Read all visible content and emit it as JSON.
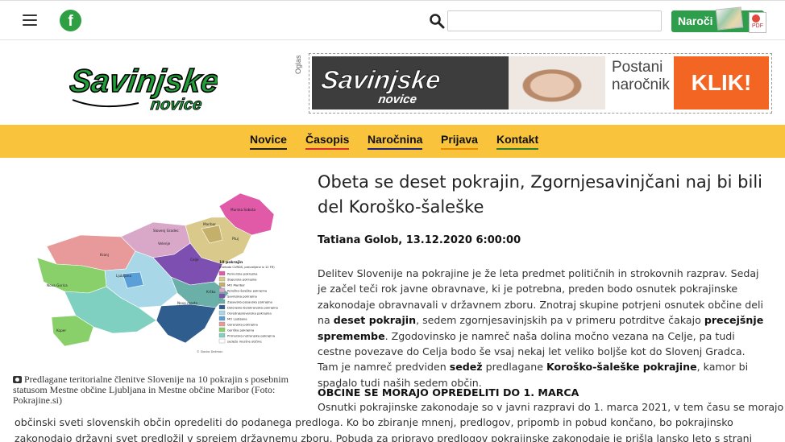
{
  "topbar": {
    "menu_icon": "hamburger-icon",
    "facebook_icon": "facebook-icon",
    "facebook_letter": "f",
    "search_icon": "search-icon",
    "search_placeholder": "",
    "subscribe_label": "Naroči",
    "pdf_label": "PDF"
  },
  "header": {
    "logo_main": "Savinjske",
    "logo_sub": "novice",
    "ad_label": "Oglas",
    "ad_logo_main": "Savinjske",
    "ad_logo_sub": "novice",
    "ad_line1": "Postani",
    "ad_line2": "naročnik",
    "ad_cta": "KLIK!"
  },
  "nav": {
    "items": [
      {
        "label": "Novice",
        "underline": "#222222"
      },
      {
        "label": "Časopis",
        "underline": "#d32f2f"
      },
      {
        "label": "Naročnina",
        "underline": "#1a237e"
      },
      {
        "label": "Prijava",
        "underline": "#e68a00"
      },
      {
        "label": "Kontakt",
        "underline": "#2e7d32"
      }
    ]
  },
  "colors": {
    "brand_green": "#2e9e4d",
    "nav_yellow": "#f9c33c",
    "ad_orange": "#f26522"
  },
  "map": {
    "legend_title": "10 pokrajin",
    "legend_subtitle": "(metoda CURDS, preureijene iz 12 FR)",
    "legend": [
      {
        "label": "Pomurska pokrajina",
        "color": "#e05aa8"
      },
      {
        "label": "Štajerska pokrajina",
        "color": "#d9c98a"
      },
      {
        "label": "MO Maribor",
        "color": "#c4b06a"
      },
      {
        "label": "Koroško-šaleška pokrajina",
        "color": "#d9a8c8"
      },
      {
        "label": "Savinjska pokrajina",
        "color": "#7c4fb0"
      },
      {
        "label": "Zasavsko-posavska pokrajina",
        "color": "#6ab0a8"
      },
      {
        "label": "Dolenjsko-belokranjska pokrajina",
        "color": "#2f5e8e"
      },
      {
        "label": "Osrednjeslovenska pokrajina",
        "color": "#a8d8e8"
      },
      {
        "label": "MO Ljubljana",
        "color": "#5a9fd8"
      },
      {
        "label": "Gorenjska pokrajina",
        "color": "#e89a9a"
      },
      {
        "label": "Goriška pokrajina",
        "color": "#8ad06a"
      },
      {
        "label": "Primorsko-notranjska pokrajina",
        "color": "#7fd0c0"
      },
      {
        "label": "sedežo mestne občine",
        "color": "#ffffff"
      }
    ],
    "place_labels": [
      "Murska Sobota",
      "Maribor",
      "Ptuj",
      "Slovenj Gradec",
      "Velenje",
      "Celje",
      "Kranj",
      "Ljubljana",
      "Novo mesto",
      "Nova Gorica",
      "Koper",
      "Krško"
    ],
    "credit": "© Slavko Dežman"
  },
  "caption": "Predlagane teritorialne členitve Slovenije na 10 pokrajin s posebnim statusom Mestne občine Ljubljana in Mestne občine Maribor (Foto: Pokrajine.si)",
  "article": {
    "title": "Obeta se deset pokrajin, Zgornjesavinjčani naj bi bili del Koroško-šaleške",
    "author_date": "Tatiana Golob, 13.12.2020 6:00:00",
    "lede_parts": [
      "Delitev Slovenije na pokrajine je že leta predmet političnih in strokovnih razprav. Sedaj je začel teči rok javne obravnave, ki je potrebna, preden bodo osnutek pokrajinske zakonodaje obravnavali v državnem zboru. Znotraj skupine potrjeni osnutek občine deli na ",
      "deset pokrajin",
      ", sedem zgornjesavinjskih pa v primeru potrditve čakajo ",
      "precejšnje spremembe",
      ". Zgodovinsko je namreč naša dolina močno vezana na Celje, pa tudi cestne povezave do Celja bodo še vsaj nekaj let veliko boljše kot do Slovenj Gradca. Tam je namreč predviden ",
      "sedež",
      " predlagane ",
      "Koroško-šaleške pokrajine",
      ", kamor bi spadalo tudi naših sedem občin."
    ],
    "subhead": "OBČINE SE MORAJO OPREDELITI DO 1. MARCA",
    "body_line1": "Osnutki pokrajinske zakonodaje so v javni razpravi do 1. marca 2021, v tem času se morajo",
    "body_line2": "občinski sveti slovenskih občin opredeliti do podanega predloga. Ko bo zbiranje mnenj, predlogov, pripomb in pobud končano, bo pokrajinsko",
    "body_line3": "zakonodajo državni svet predložil v sprejem državnemu zboru. Pobuda za pripravo predlogov pokrajinske zakonodaje je prišla lansko leto s strani"
  }
}
